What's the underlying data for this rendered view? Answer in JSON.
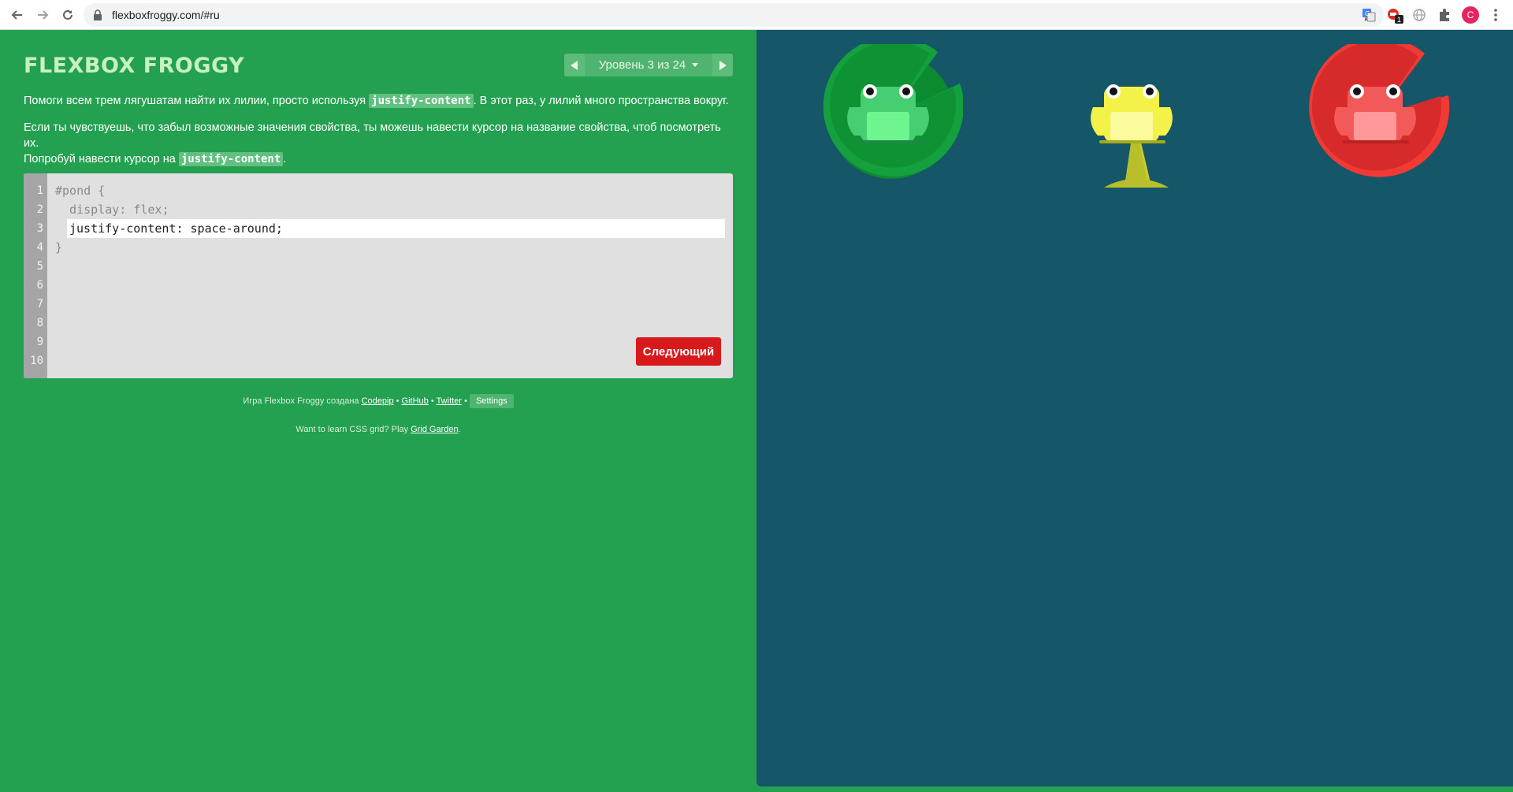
{
  "browser": {
    "url": "flexboxfroggy.com/#ru",
    "profile_initial": "C",
    "extension_badge": "1",
    "icons": [
      "back-arrow-icon",
      "forward-arrow-icon",
      "reload-icon",
      "lock-icon",
      "star-icon",
      "translate-icon",
      "adblock-icon",
      "globe-icon",
      "puzzle-icon",
      "menu-dots-icon"
    ]
  },
  "app": {
    "logo": "FLEXBOX FROGGY",
    "level_label": "Уровень 3 из 24",
    "instructions": {
      "p1_before": "Помоги всем трем лягушатам найти их лилии, просто используя ",
      "p1_code": "justify-content",
      "p1_after": ". В этот раз, у лилий много пространства вокруг.",
      "p2_line1": "Если ты чувствуешь, что забыл возможные значения свойства, ты можешь навести курсор на название свойства, чтоб посмотреть их.",
      "p2_line2_before": "Попробуй навести курсор на ",
      "p2_code": "justify-content",
      "p2_after": "."
    },
    "editor": {
      "line_numbers": [
        "1",
        "2",
        "3",
        "4",
        "5",
        "6",
        "7",
        "8",
        "9",
        "10"
      ],
      "line1": "#pond {",
      "line2": "  display: flex;",
      "input_value": "justify-content: space-around;",
      "line4": "}",
      "next_button": "Следующий"
    },
    "footer": {
      "credit_before": "Игра Flexbox Froggy создана ",
      "codepip": "Codepip",
      "sep1": " • ",
      "github": "GitHub",
      "sep2": " • ",
      "twitter": "Twitter",
      "sep3": " • ",
      "settings": "Settings",
      "grid_before": "Want to learn CSS grid? Play ",
      "grid_link": "Grid Garden",
      "grid_after": "."
    }
  },
  "colors": {
    "background_green": "#24a150",
    "pond": "#155768",
    "next_button": "#d7191c"
  },
  "frogs": [
    {
      "color": "green",
      "lily": "#14a03c",
      "lily_dark": "#0b8a30",
      "body": "#46cf72",
      "belly": "#6ff58f"
    },
    {
      "color": "yellow",
      "lily": "#c6cc30",
      "lily_dark": "#b2b824",
      "body": "#f2f248",
      "belly": "#fbfb9e"
    },
    {
      "color": "red",
      "lily": "#f23a35",
      "lily_dark": "#d72b2b",
      "body": "#f25a5a",
      "belly": "#ff9898"
    }
  ]
}
